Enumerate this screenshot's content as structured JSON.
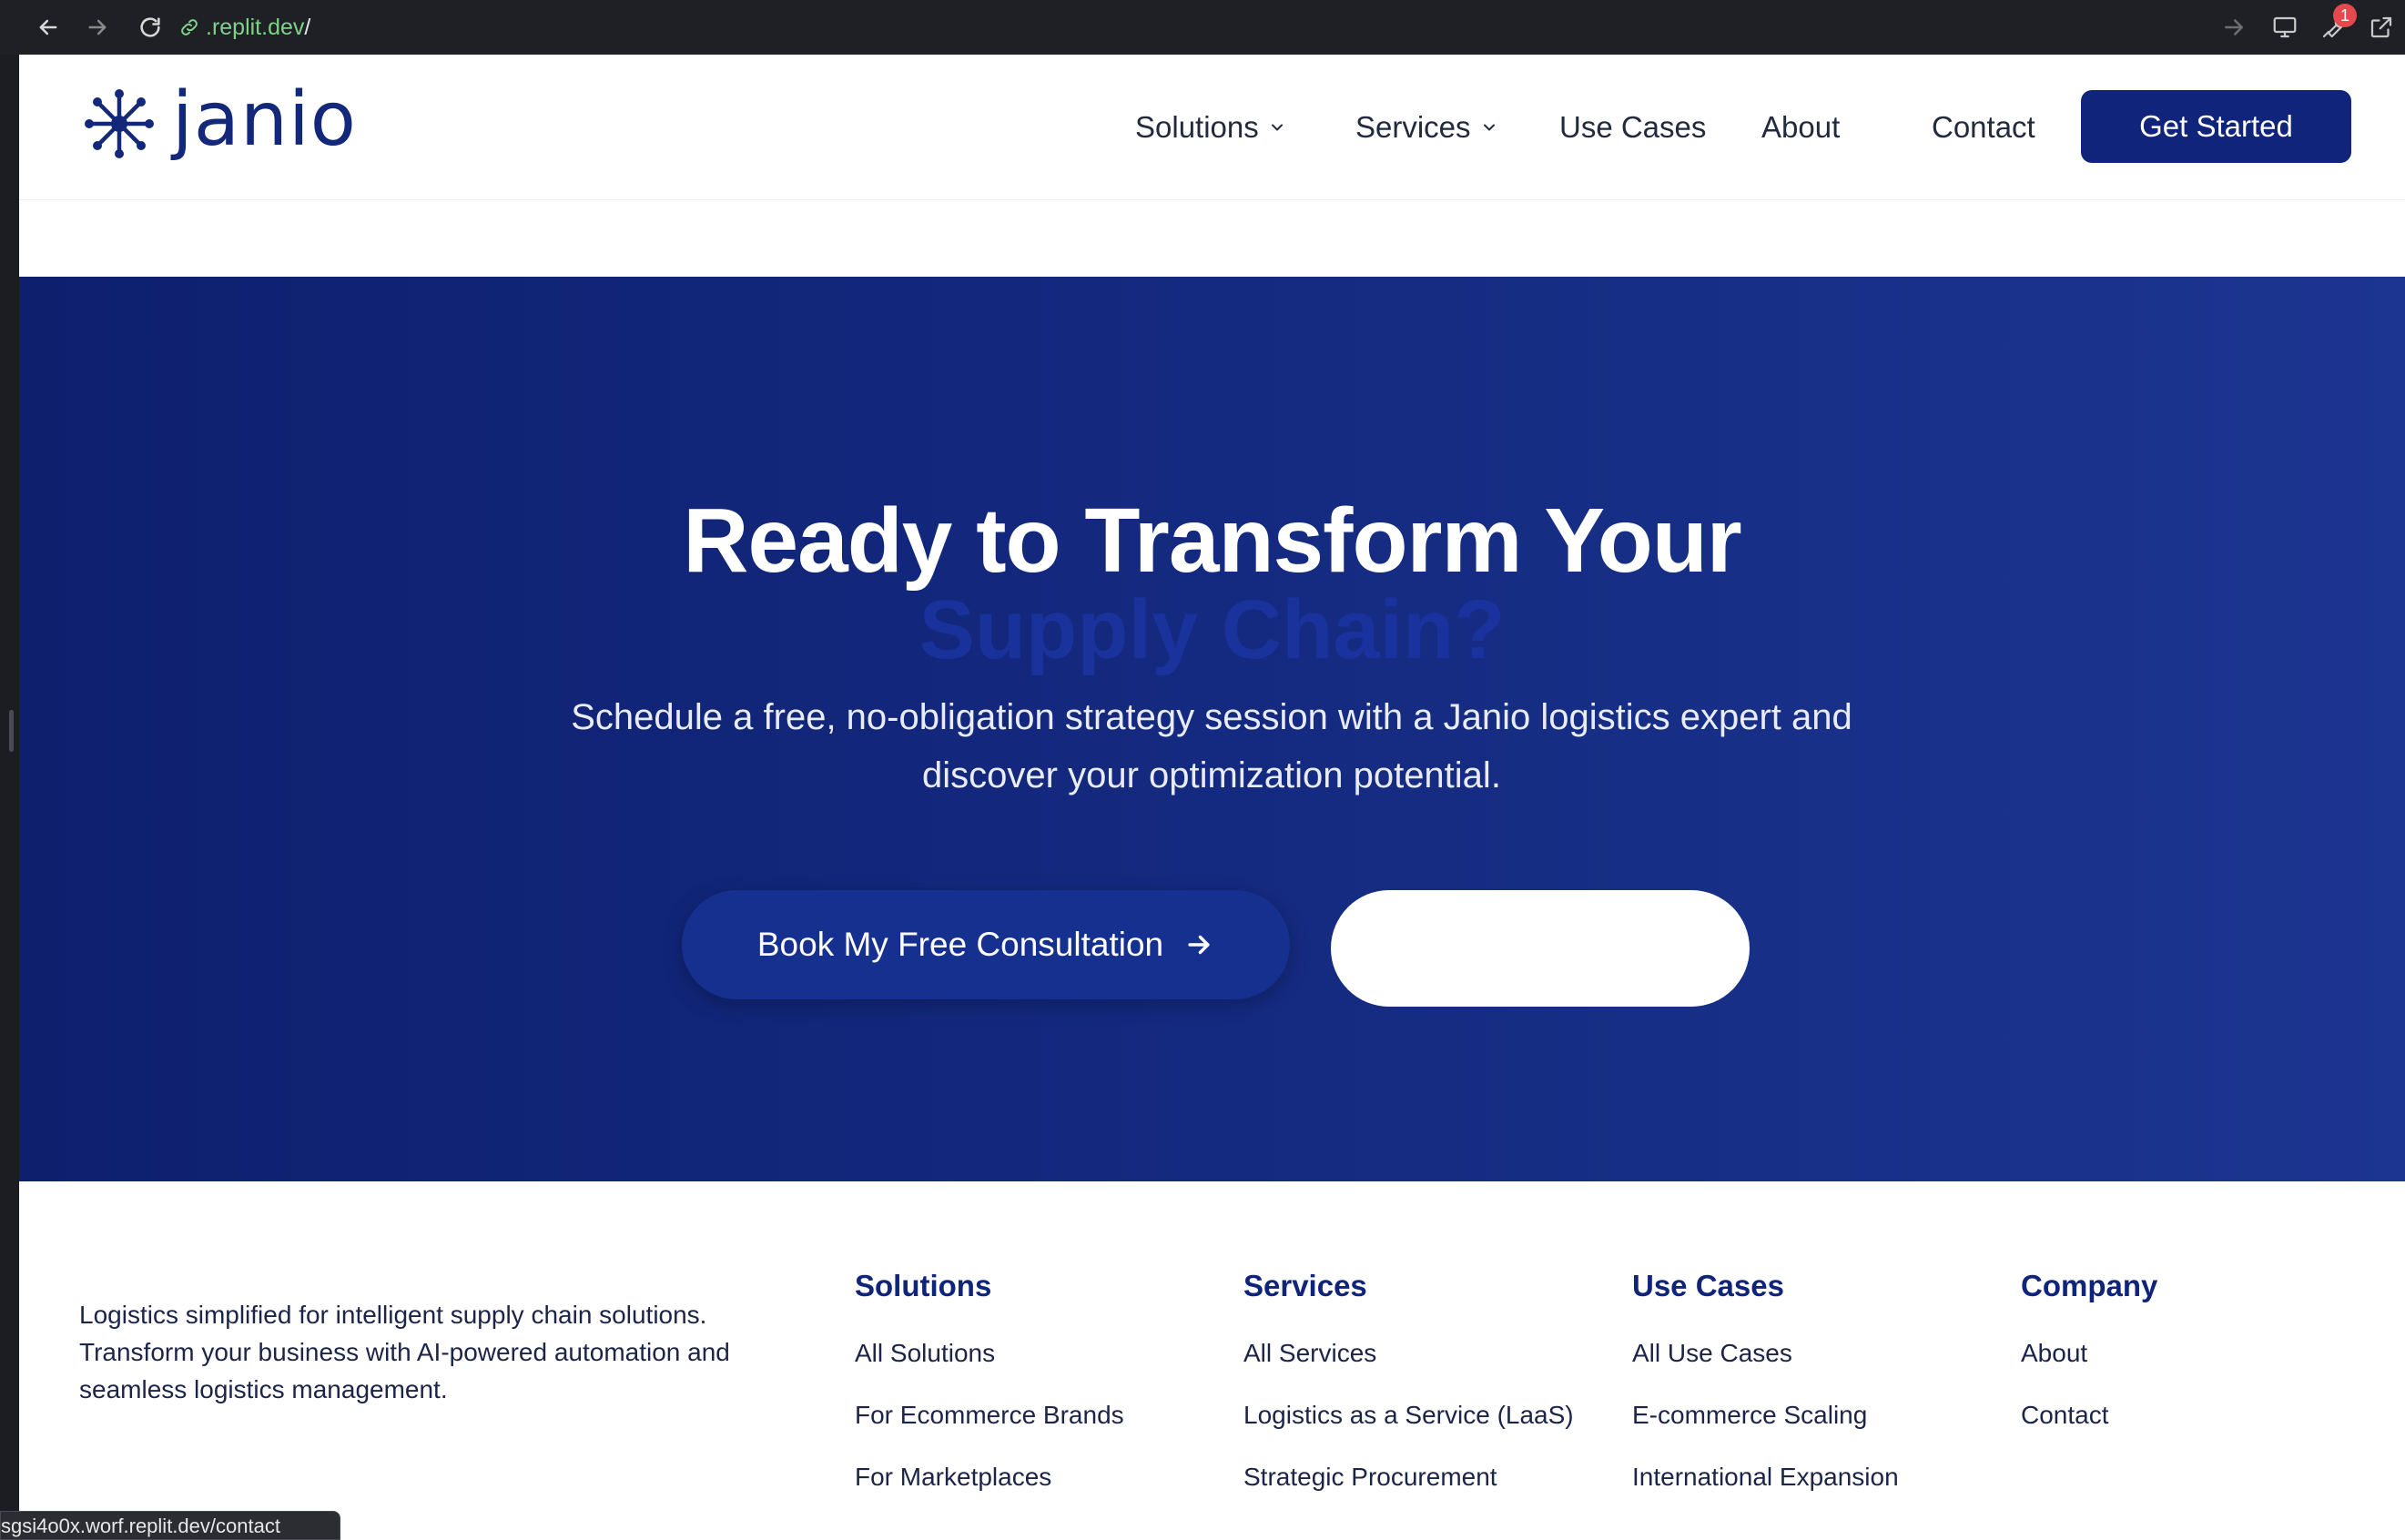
{
  "browser": {
    "url_domain": ".replit.dev",
    "url_path": "/",
    "notification_count": "1",
    "status_link": "sgsi4o0x.worf.replit.dev/contact"
  },
  "header": {
    "logo_text": "janio",
    "nav": [
      {
        "label": "Solutions"
      },
      {
        "label": "Services"
      },
      {
        "label": "Use Cases"
      },
      {
        "label": "About"
      },
      {
        "label": "Contact"
      }
    ],
    "cta_label": "Get Started"
  },
  "hero": {
    "title_line1": "Ready to Transform Your",
    "title_line2": "Supply Chain?",
    "subtitle_line1": "Schedule a free, no-obligation strategy session with a Janio logistics expert and",
    "subtitle_line2": "discover your optimization potential.",
    "primary_button": "Book My Free Consultation",
    "secondary_button": ""
  },
  "footer": {
    "description_line1": "Logistics simplified for intelligent supply chain solutions.",
    "description_line2": "Transform your business with AI-powered automation and",
    "description_line3": "seamless logistics management.",
    "columns": [
      {
        "title": "Solutions",
        "links": [
          "All Solutions",
          "For Ecommerce Brands",
          "For Marketplaces"
        ]
      },
      {
        "title": "Services",
        "links": [
          "All Services",
          "Logistics as a Service (LaaS)",
          "Strategic Procurement"
        ]
      },
      {
        "title": "Use Cases",
        "links": [
          "All Use Cases",
          "E-commerce Scaling",
          "International Expansion"
        ]
      },
      {
        "title": "Company",
        "links": [
          "About",
          "Contact"
        ]
      }
    ]
  },
  "colors": {
    "brand_navy": "#0f247a",
    "hero_gradient_start": "#0e1f6e",
    "hero_gradient_end": "#1c3590",
    "url_green": "#7ed288"
  },
  "icons": [
    "back-arrow-icon",
    "forward-arrow-icon",
    "reload-icon",
    "link-icon",
    "chevron-down-icon",
    "arrow-right-icon",
    "monitor-icon",
    "wrench-icon",
    "external-link-icon",
    "logo-mark-icon"
  ]
}
